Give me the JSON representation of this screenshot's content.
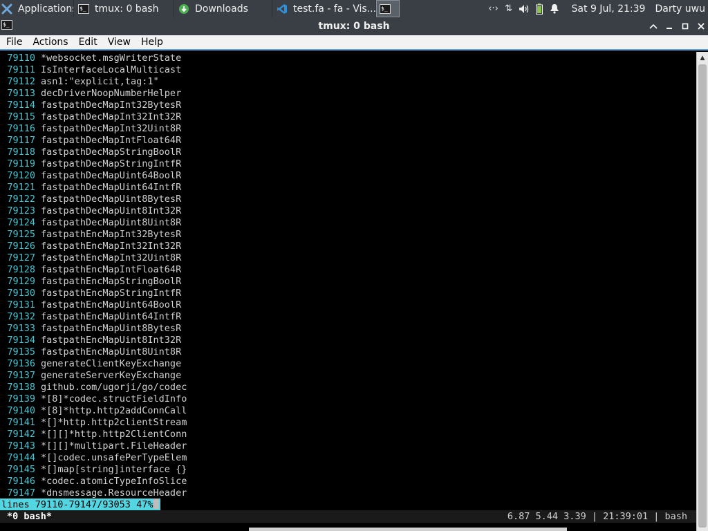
{
  "panel": {
    "tasks": [
      {
        "label": "Applications",
        "icon": "xfce-logo-icon"
      },
      {
        "label": "tmux: 0 bash",
        "icon": "terminal-icon"
      },
      {
        "label": "Downloads",
        "icon": "downloads-icon"
      },
      {
        "label": "test.fa - fa - Vis...",
        "icon": "vscode-icon"
      }
    ],
    "active_task_icon": "terminal-icon",
    "clock": "Sat  9 Jul, 21:39",
    "user": "Darty uwu",
    "tray_icons": [
      "network-icon",
      "transfer-icon",
      "volume-icon",
      "battery-icon",
      "notification-bell-icon"
    ]
  },
  "window": {
    "title": "tmux: 0 bash"
  },
  "menubar": {
    "items": [
      "File",
      "Actions",
      "Edit",
      "View",
      "Help"
    ]
  },
  "terminal": {
    "lines": [
      {
        "n": "79110",
        "t": "*websocket.msgWriterState"
      },
      {
        "n": "79111",
        "t": "IsInterfaceLocalMulticast"
      },
      {
        "n": "79112",
        "t": "asn1:\"explicit,tag:1\""
      },
      {
        "n": "79113",
        "t": "decDriverNoopNumberHelper"
      },
      {
        "n": "79114",
        "t": "fastpathDecMapInt32BytesR"
      },
      {
        "n": "79115",
        "t": "fastpathDecMapInt32Int32R"
      },
      {
        "n": "79116",
        "t": "fastpathDecMapInt32Uint8R"
      },
      {
        "n": "79117",
        "t": "fastpathDecMapIntFloat64R"
      },
      {
        "n": "79118",
        "t": "fastpathDecMapStringBoolR"
      },
      {
        "n": "79119",
        "t": "fastpathDecMapStringIntfR"
      },
      {
        "n": "79120",
        "t": "fastpathDecMapUint64BoolR"
      },
      {
        "n": "79121",
        "t": "fastpathDecMapUint64IntfR"
      },
      {
        "n": "79122",
        "t": "fastpathDecMapUint8BytesR"
      },
      {
        "n": "79123",
        "t": "fastpathDecMapUint8Int32R"
      },
      {
        "n": "79124",
        "t": "fastpathDecMapUint8Uint8R"
      },
      {
        "n": "79125",
        "t": "fastpathEncMapInt32BytesR"
      },
      {
        "n": "79126",
        "t": "fastpathEncMapInt32Int32R"
      },
      {
        "n": "79127",
        "t": "fastpathEncMapInt32Uint8R"
      },
      {
        "n": "79128",
        "t": "fastpathEncMapIntFloat64R"
      },
      {
        "n": "79129",
        "t": "fastpathEncMapStringBoolR"
      },
      {
        "n": "79130",
        "t": "fastpathEncMapStringIntfR"
      },
      {
        "n": "79131",
        "t": "fastpathEncMapUint64BoolR"
      },
      {
        "n": "79132",
        "t": "fastpathEncMapUint64IntfR"
      },
      {
        "n": "79133",
        "t": "fastpathEncMapUint8BytesR"
      },
      {
        "n": "79134",
        "t": "fastpathEncMapUint8Int32R"
      },
      {
        "n": "79135",
        "t": "fastpathEncMapUint8Uint8R"
      },
      {
        "n": "79136",
        "t": "generateClientKeyExchange"
      },
      {
        "n": "79137",
        "t": "generateServerKeyExchange"
      },
      {
        "n": "79138",
        "t": "github.com/ugorji/go/codec"
      },
      {
        "n": "79139",
        "t": "*[8]*codec.structFieldInfo"
      },
      {
        "n": "79140",
        "t": "*[8]*http.http2addConnCall"
      },
      {
        "n": "79141",
        "t": "*[]*http.http2clientStream"
      },
      {
        "n": "79142",
        "t": "*[][]*http.http2ClientConn"
      },
      {
        "n": "79143",
        "t": "*[][]*multipart.FileHeader"
      },
      {
        "n": "79144",
        "t": "*[]codec.unsafePerTypeElem"
      },
      {
        "n": "79145",
        "t": "*[]map[string]interface {}"
      },
      {
        "n": "79146",
        "t": "*codec.atomicTypeInfoSlice"
      },
      {
        "n": "79147",
        "t": "*dnsmessage.ResourceHeader"
      }
    ],
    "less_status": "lines 79110-79147/93053 47%"
  },
  "tmux": {
    "window_label": "*0 bash*",
    "status_right": "6.87 5.44 3.39 | 21:39:01 | bash"
  },
  "colors": {
    "panel_bg": "#3a3f45",
    "line_number": "#4ec4d0",
    "text": "#d0d0d0",
    "status_bg": "#52d6e2"
  }
}
